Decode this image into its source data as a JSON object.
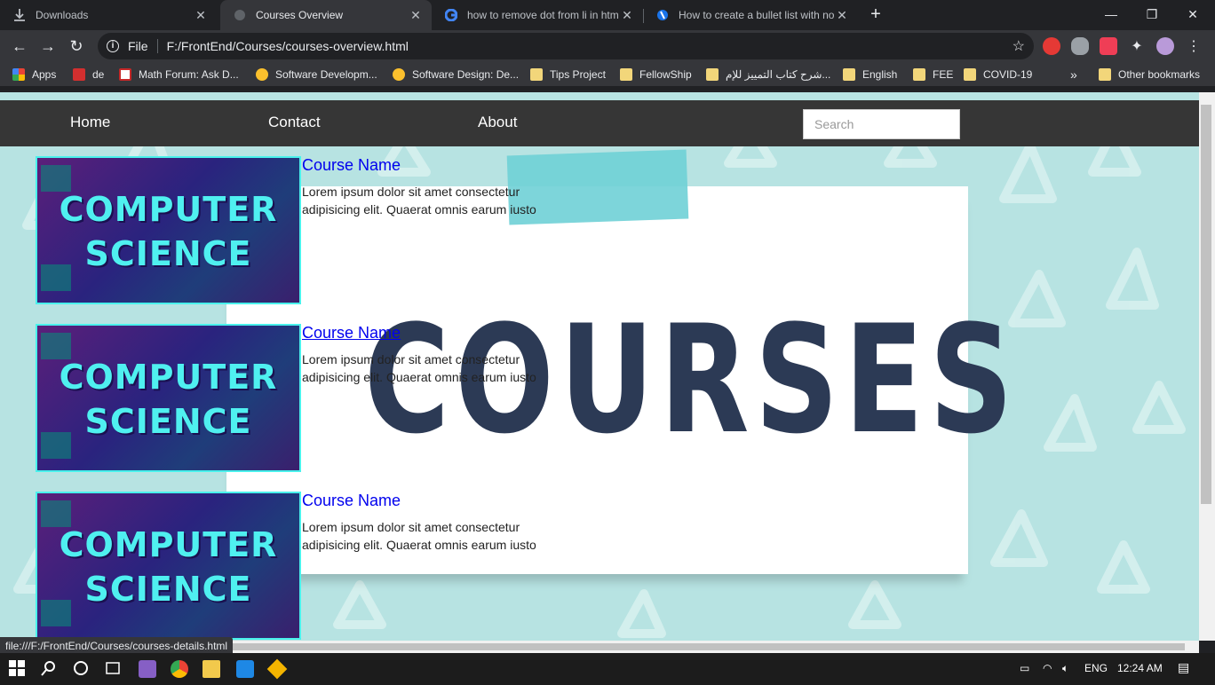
{
  "tabs": [
    {
      "title": "Downloads",
      "icon": "download-icon"
    },
    {
      "title": "Courses Overview",
      "icon": "globe-icon",
      "active": true
    },
    {
      "title": "how to remove dot from li in htm",
      "icon": "google-icon"
    },
    {
      "title": "How to create a bullet list with no",
      "icon": "site-icon"
    }
  ],
  "toolbar": {
    "scheme": "File",
    "url": "F:/FrontEnd/Courses/courses-overview.html"
  },
  "bookmarks": [
    {
      "label": "Apps",
      "icon": "apps-icon"
    },
    {
      "label": "de",
      "icon": "bookmark-red-icon"
    },
    {
      "label": "Math Forum: Ask D...",
      "icon": "math-icon"
    },
    {
      "label": "Software Developm...",
      "icon": "sdlc-icon"
    },
    {
      "label": "Software Design: De...",
      "icon": "sdlc-icon"
    },
    {
      "label": "Tips Project",
      "icon": "folder-icon"
    },
    {
      "label": "FellowShip",
      "icon": "folder-icon"
    },
    {
      "label": "شرح كتاب التمييز للإم...",
      "icon": "folder-icon"
    },
    {
      "label": "English",
      "icon": "folder-icon"
    },
    {
      "label": "FEE",
      "icon": "folder-icon"
    },
    {
      "label": "COVID-19",
      "icon": "folder-icon"
    },
    {
      "label": "»",
      "icon": "overflow-icon"
    },
    {
      "label": "Other bookmarks",
      "icon": "folder-icon"
    }
  ],
  "page": {
    "nav": {
      "home": "Home",
      "contact": "Contact",
      "about": "About"
    },
    "search_placeholder": "Search",
    "hero_word": "COURSES",
    "thumb_line1": "COMPUTER",
    "thumb_line2": "SCIENCE",
    "courses": [
      {
        "name": "Course Name",
        "description": "Lorem ipsum dolor sit amet consectetur adipisicing elit. Quaerat omnis earum iusto"
      },
      {
        "name": "Course Name",
        "description": "Lorem ipsum dolor sit amet consectetur adipisicing elit. Quaerat omnis earum iusto"
      },
      {
        "name": "Course Name",
        "description": "Lorem ipsum dolor sit amet consectetur adipisicing elit. Quaerat omnis earum iusto"
      }
    ]
  },
  "status_url": "file:///F:/FrontEnd/Courses/courses-details.html",
  "taskbar": {
    "lang": "ENG",
    "time": "12:24 AM"
  },
  "colors": {
    "accent_cyan": "#49f1ec",
    "navbar": "#363636",
    "page_bg": "#b7e3e2",
    "link": "#0000ee"
  }
}
